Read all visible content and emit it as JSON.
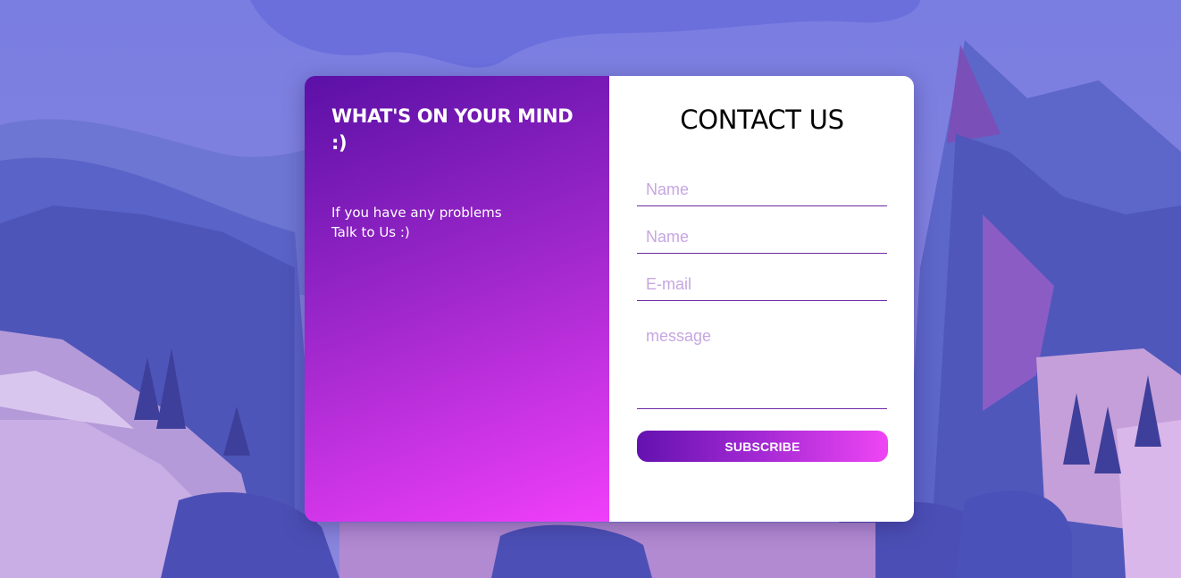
{
  "colors": {
    "panel_gradient_start": "#5b10a6",
    "panel_gradient_end": "#f03ffa",
    "input_underline": "#6a2aa3",
    "placeholder": "#c7a6e2",
    "button_gradient_start": "#6411b0",
    "button_gradient_end": "#ef45f4"
  },
  "left_panel": {
    "heading": "WHAT'S ON YOUR MIND :)",
    "subtext": "If you have any problems\nTalk to Us :)"
  },
  "form": {
    "title": "CONTACT US",
    "fields": [
      {
        "placeholder": "Name",
        "value": ""
      },
      {
        "placeholder": "Name",
        "value": ""
      },
      {
        "placeholder": "E-mail",
        "value": ""
      }
    ],
    "message_placeholder": "message",
    "submit_label": "SUBSCRIBE"
  }
}
